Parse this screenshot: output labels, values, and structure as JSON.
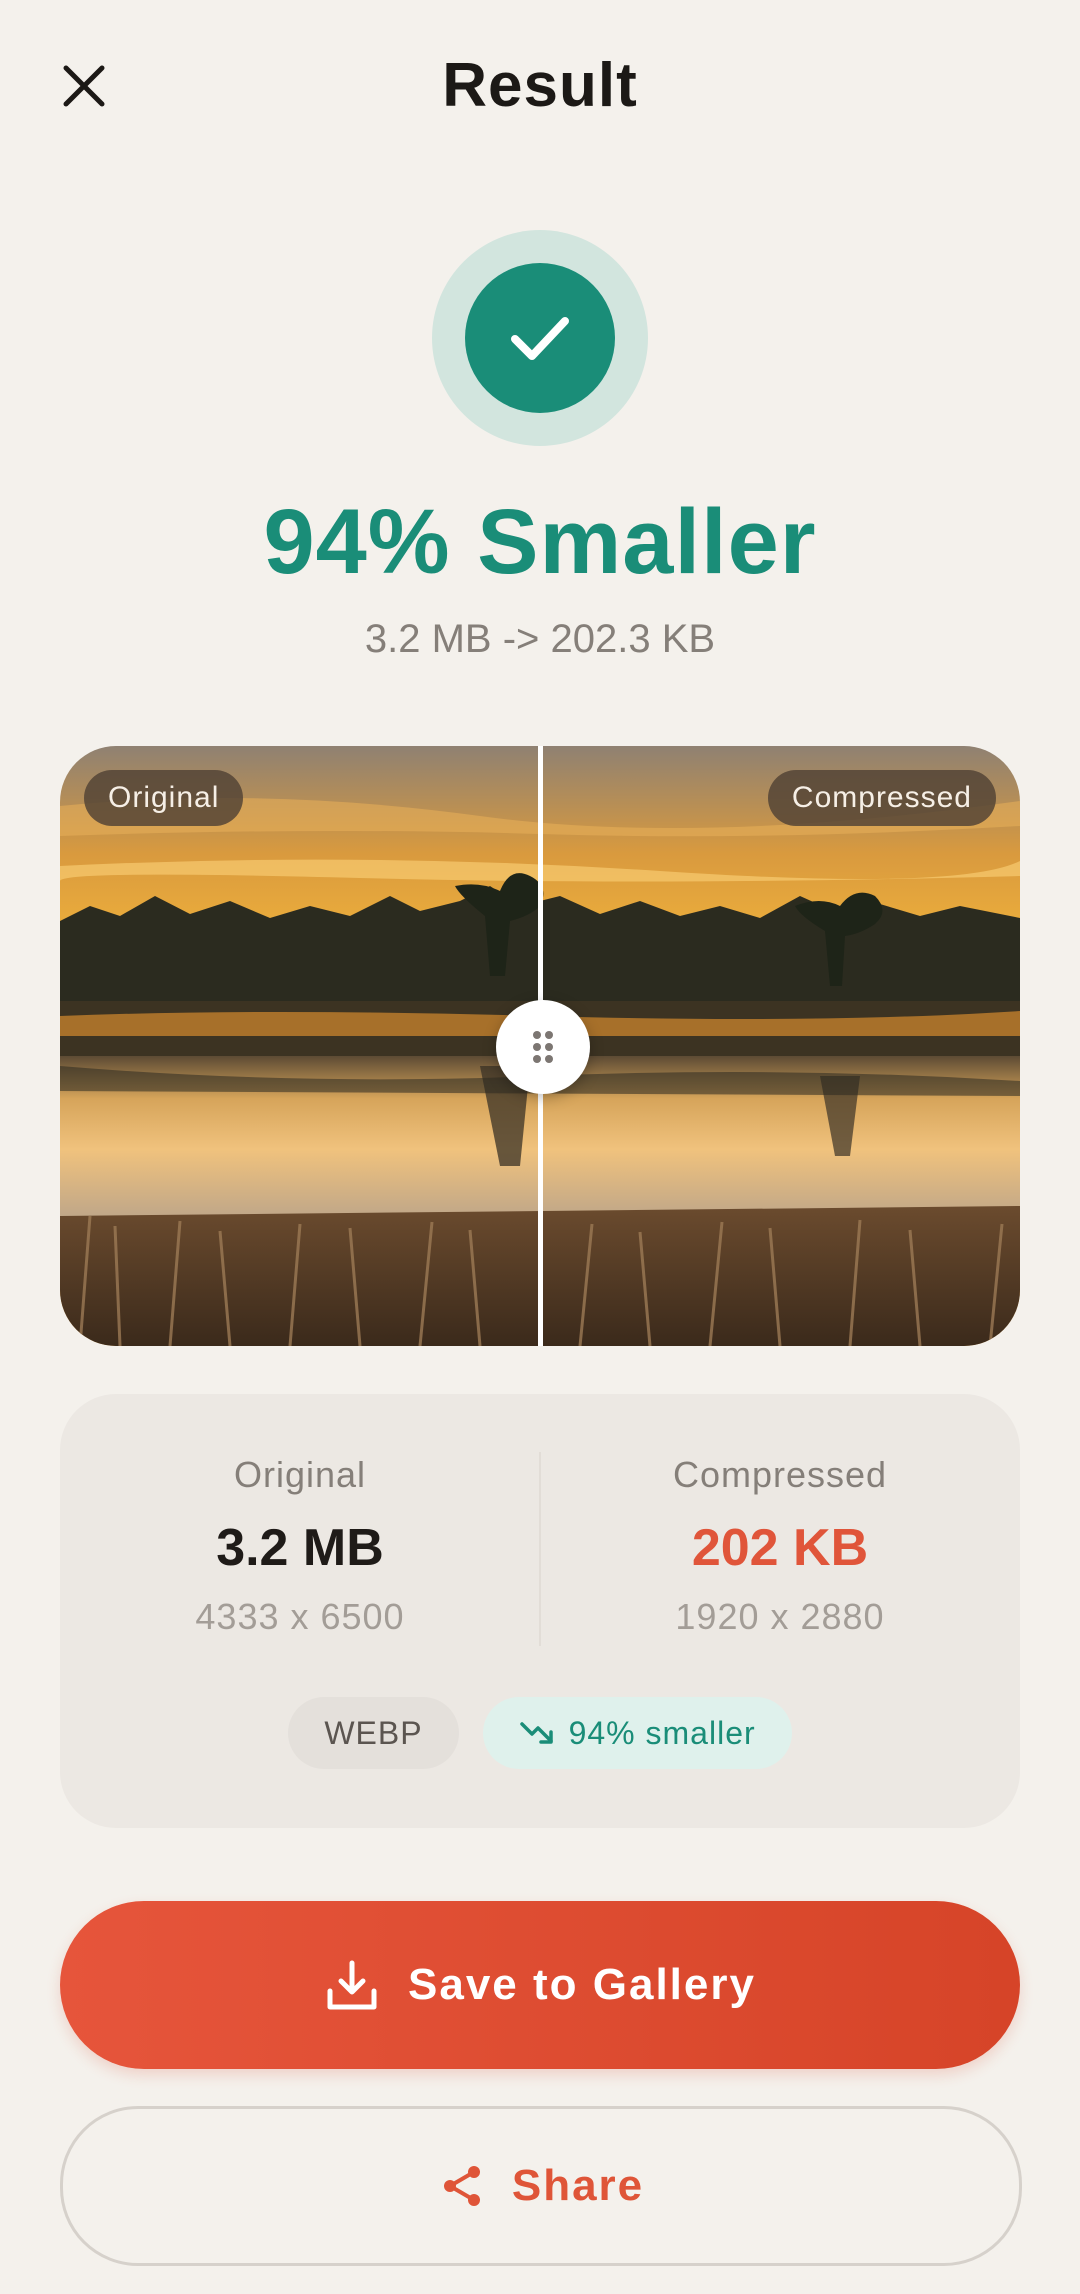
{
  "header": {
    "title": "Result",
    "close_icon": "close-icon"
  },
  "result": {
    "status_icon": "check-icon",
    "headline": "94% Smaller",
    "size_change": "3.2 MB -> 202.3 KB"
  },
  "comparison": {
    "left_label": "Original",
    "right_label": "Compressed",
    "handle_icon": "drag-handle-icon"
  },
  "stats": {
    "original": {
      "label": "Original",
      "size": "3.2 MB",
      "dimensions": "4333 x 6500"
    },
    "compressed": {
      "label": "Compressed",
      "size": "202 KB",
      "dimensions": "1920 x 2880"
    },
    "format": "WEBP",
    "savings": "94% smaller",
    "savings_icon": "trending-down-icon"
  },
  "actions": {
    "save_label": "Save to Gallery",
    "save_icon": "download-icon",
    "share_label": "Share",
    "share_icon": "share-icon"
  },
  "colors": {
    "background": "#f4f1ec",
    "accent_green": "#1a8d78",
    "accent_orange": "#e0553a"
  }
}
